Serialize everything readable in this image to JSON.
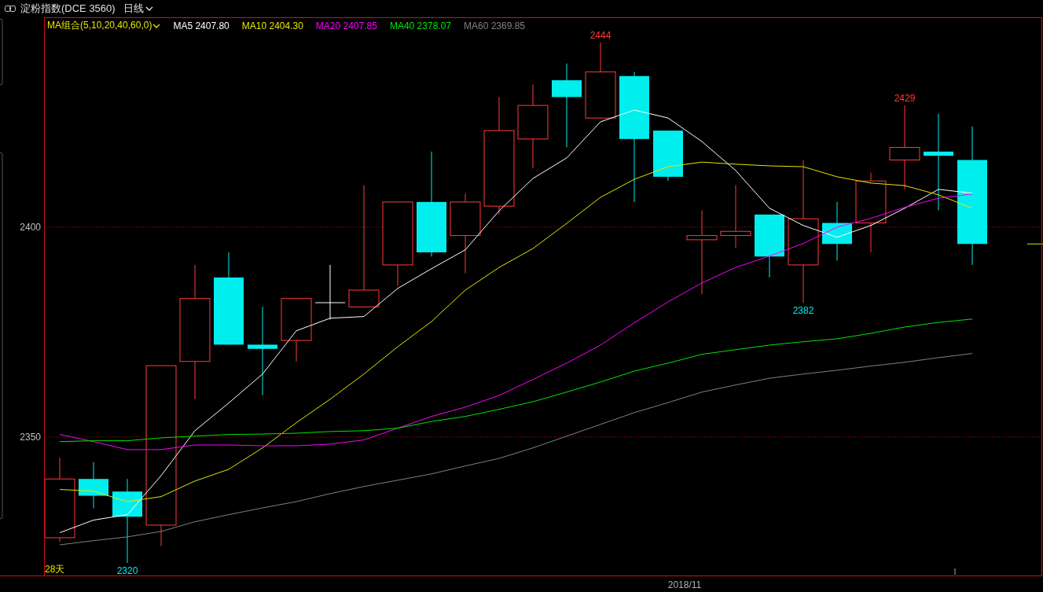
{
  "header": {
    "title": "淀粉指数(DCE 3560)",
    "period": "日线"
  },
  "chart": {
    "indicator": "MA组合(5,10,20,40,60,0)",
    "day_count": "28天",
    "readings": [
      "2407.80",
      "2404.30",
      "2407.85",
      "2378.07",
      "2369.85"
    ],
    "chart_data": {
      "type": "line",
      "ylim": [
        2317,
        2450
      ],
      "yticks": [
        2350,
        2400
      ],
      "categories": [
        null,
        null,
        null,
        null,
        null,
        null,
        null,
        null,
        null,
        null,
        null,
        null,
        null,
        null,
        null,
        null,
        null,
        null,
        "2018/11",
        null,
        null,
        null,
        null,
        null,
        null,
        null,
        null,
        null
      ],
      "series": [
        {
          "name": "MA5",
          "color": "#ffffff",
          "values": [
            2327.2,
            2330.2,
            2331.5,
            2340.8,
            2351.5,
            2358.1,
            2365,
            2375.3,
            2378.3,
            2378.7,
            2385.4,
            2390.1,
            2394.6,
            2403.9,
            2411.6,
            2416.5,
            2425.1,
            2427.9,
            2426,
            2420.4,
            2413.5,
            2404.5,
            2400.4,
            2397.6,
            2400.4,
            2404.5,
            2409,
            2408.1
          ]
        },
        {
          "name": "MA10",
          "color": "#e6e600",
          "values": [
            2337.5,
            2337.1,
            2334.6,
            2335.8,
            2339.5,
            2342.3,
            2347.4,
            2353.4,
            2359,
            2365,
            2371.5,
            2377.5,
            2385,
            2390.4,
            2394.9,
            2400.9,
            2407.1,
            2411.4,
            2414.4,
            2415.5,
            2415,
            2414.6,
            2414.4,
            2412,
            2410.5,
            2409.9,
            2407.7,
            2404.5
          ]
        },
        {
          "name": "MA20",
          "color": "#ff00ff",
          "values": [
            2350.6,
            2348.9,
            2347,
            2347,
            2348.1,
            2348.1,
            2347.9,
            2347.9,
            2348.3,
            2349.3,
            2352.1,
            2354.9,
            2357.1,
            2359.9,
            2363.7,
            2367.6,
            2371.9,
            2377.2,
            2382.2,
            2386.7,
            2390.4,
            2393.1,
            2396.1,
            2400,
            2402.1,
            2404.7,
            2406.9,
            2407.9
          ]
        },
        {
          "name": "MA40",
          "color": "#00e600",
          "values": [
            2348.9,
            2349.1,
            2349.1,
            2349.8,
            2350.2,
            2350.6,
            2350.7,
            2350.9,
            2351.3,
            2351.5,
            2352.1,
            2353.7,
            2354.9,
            2356.6,
            2358.4,
            2360.7,
            2363.1,
            2365.7,
            2367.6,
            2369.7,
            2370.8,
            2371.9,
            2372.7,
            2373.4,
            2374.7,
            2376.2,
            2377.3,
            2378.1
          ]
        },
        {
          "name": "MA60",
          "color": "#808080",
          "values": [
            2324.3,
            2325.3,
            2326.2,
            2327.5,
            2329.8,
            2331.5,
            2333.1,
            2334.6,
            2336.5,
            2338.2,
            2339.7,
            2341.2,
            2343.1,
            2344.9,
            2347.4,
            2350.2,
            2353,
            2355.8,
            2358.2,
            2360.7,
            2362.4,
            2364,
            2365,
            2365.9,
            2366.9,
            2367.8,
            2368.9,
            2369.9
          ]
        }
      ],
      "annotations": [
        "2444",
        "2320",
        "2382",
        "2429"
      ]
    }
  }
}
